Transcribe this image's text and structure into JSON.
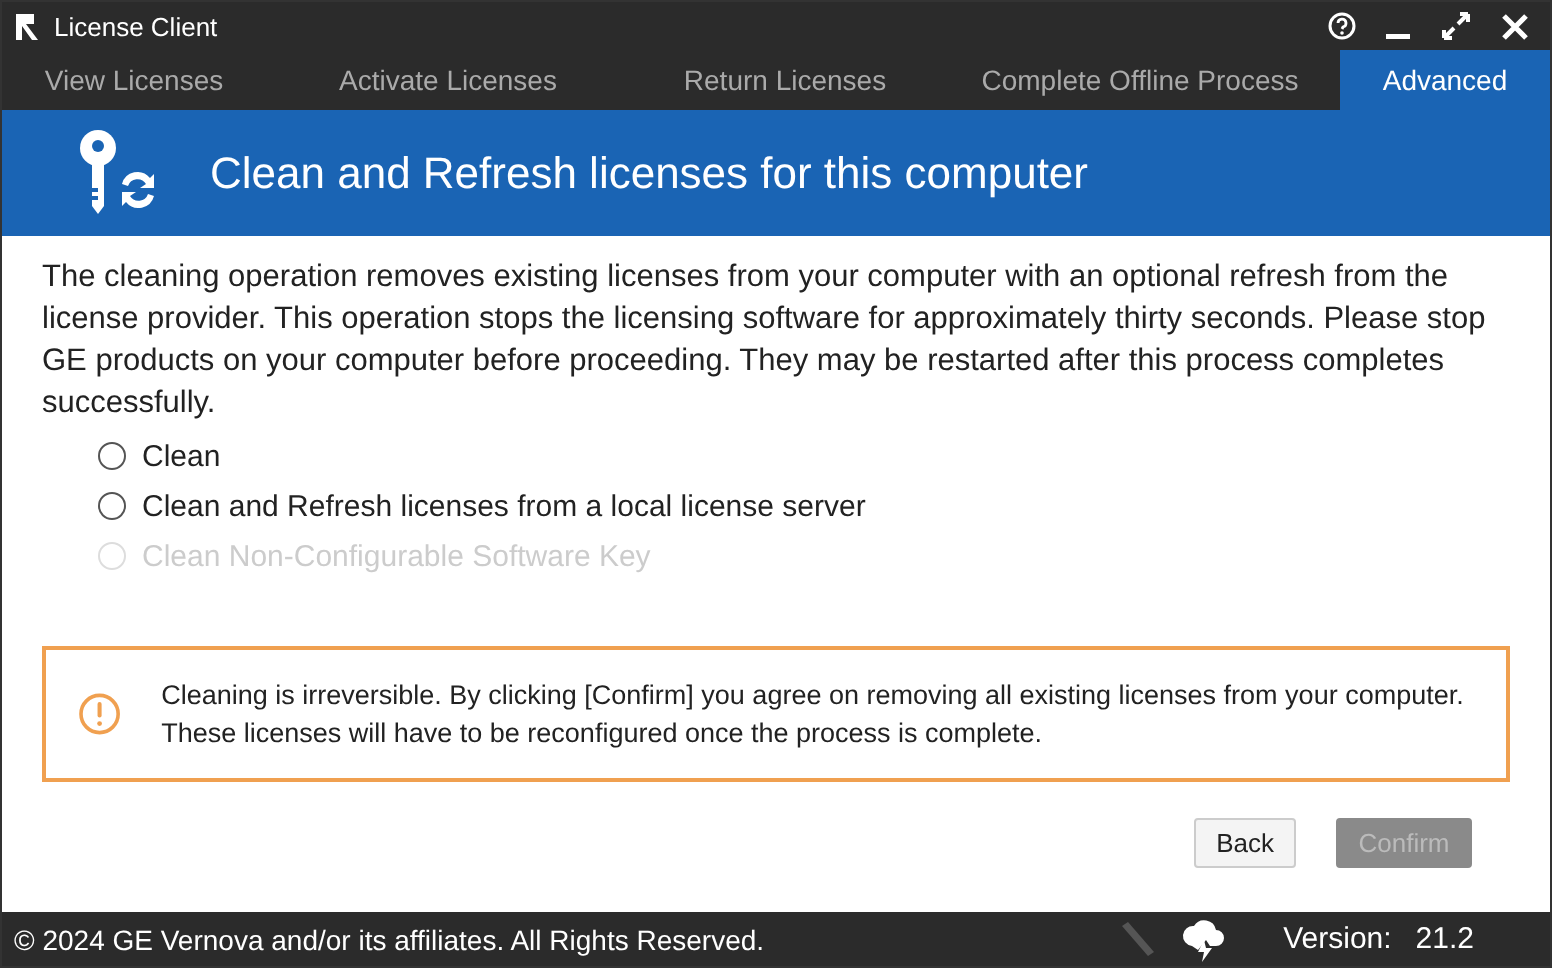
{
  "window": {
    "title": "License Client"
  },
  "tabs": [
    {
      "label": "View Licenses",
      "selected": false
    },
    {
      "label": "Activate Licenses",
      "selected": false
    },
    {
      "label": "Return Licenses",
      "selected": false
    },
    {
      "label": "Complete Offline Process",
      "selected": false
    },
    {
      "label": "Advanced",
      "selected": true
    }
  ],
  "header": {
    "title": "Clean and Refresh licenses for this computer"
  },
  "description": "The cleaning operation removes existing licenses from your computer with an optional refresh from the license provider. This operation stops the licensing software for approximately thirty seconds. Please stop GE products on your computer before proceeding. They may be restarted after this process completes successfully.",
  "options": [
    {
      "label": "Clean",
      "selected": false,
      "disabled": false
    },
    {
      "label": "Clean and Refresh licenses from a local license server",
      "selected": false,
      "disabled": false
    },
    {
      "label": "Clean Non-Configurable Software Key",
      "selected": false,
      "disabled": true
    }
  ],
  "warning": "Cleaning is irreversible. By clicking [Confirm] you agree on removing all existing licenses from your computer. These licenses will have to be reconfigured once the process is complete.",
  "buttons": [
    {
      "label": "Back",
      "disabled": false
    },
    {
      "label": "Confirm",
      "disabled": true
    }
  ],
  "status_bar": {
    "copyright": "© 2024 GE Vernova and/or its affiliates.  All Rights Reserved.",
    "version_label": "Version:",
    "version": "21.2"
  }
}
